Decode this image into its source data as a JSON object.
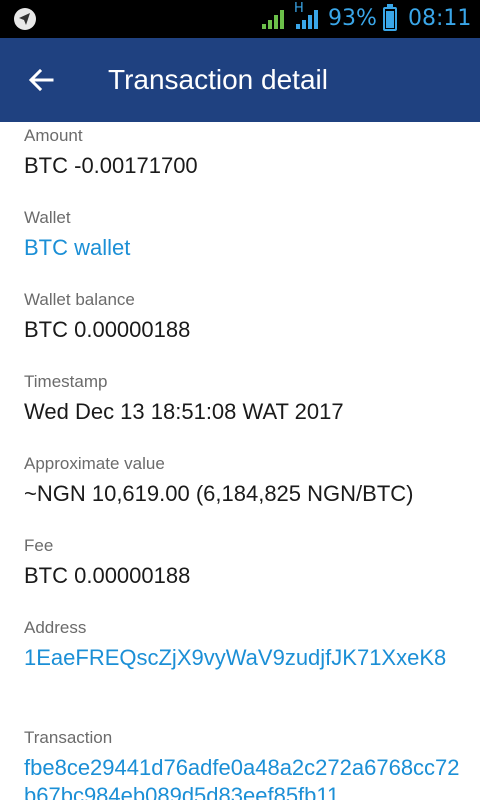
{
  "status_bar": {
    "network_label": "H",
    "battery_percent_text": "93%",
    "battery_level": 0.93,
    "time": "08:11",
    "icons": [
      "location-icon",
      "signal-icon",
      "signal-h-icon",
      "battery-icon"
    ]
  },
  "app_bar": {
    "back_icon": "arrow-left-icon",
    "title": "Transaction detail",
    "background": "#1f4180"
  },
  "details": [
    {
      "label": "Amount",
      "value": "BTC -0.00171700",
      "link": false
    },
    {
      "label": "Wallet",
      "value": "BTC wallet",
      "link": true
    },
    {
      "label": "Wallet balance",
      "value": "BTC 0.00000188",
      "link": false
    },
    {
      "label": "Timestamp",
      "value": "Wed Dec 13 18:51:08 WAT 2017",
      "link": false
    },
    {
      "label": "Approximate value",
      "value": "~NGN 10,619.00 (6,184,825 NGN/BTC)",
      "link": false
    },
    {
      "label": "Fee",
      "value": "BTC 0.00000188",
      "link": false
    },
    {
      "label": "Address",
      "value": "1EaeFREQscZjX9vyWaV9zudjfJK71XxeK8",
      "link": true
    },
    {
      "label": "Transaction",
      "value": "fbe8ce29441d76adfe0a48a2c272a6768cc72b67bc984eb089d5d83eef85fb11",
      "link": true
    }
  ],
  "colors": {
    "link": "#1b8fd6",
    "label": "#6b6b6b",
    "value": "#1a1a1a"
  }
}
